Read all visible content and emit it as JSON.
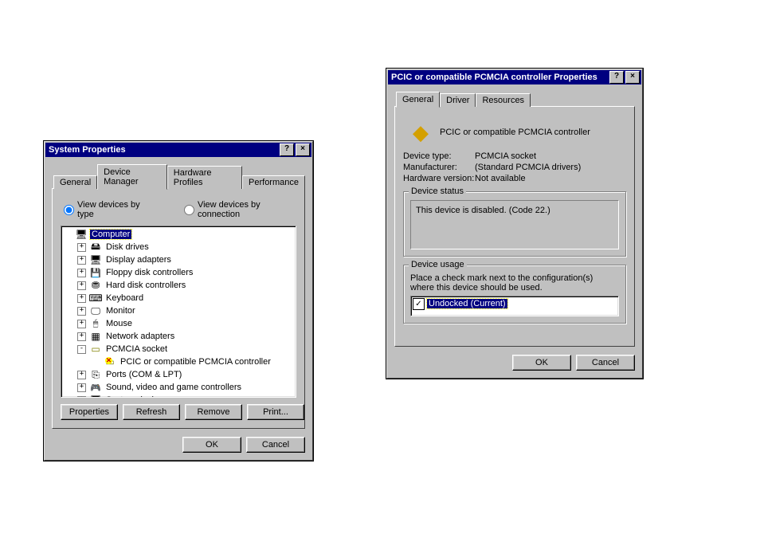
{
  "dlg1": {
    "title": "System Properties",
    "tabs": [
      "General",
      "Device Manager",
      "Hardware Profiles",
      "Performance"
    ],
    "active_tab": 1,
    "radio1": "View devices by type",
    "radio2": "View devices by connection",
    "tree": [
      {
        "indent": 0,
        "exp": "",
        "icon": "computer",
        "label": "Computer",
        "selected": true
      },
      {
        "indent": 1,
        "exp": "+",
        "icon": "disk",
        "label": "Disk drives"
      },
      {
        "indent": 1,
        "exp": "+",
        "icon": "display",
        "label": "Display adapters"
      },
      {
        "indent": 1,
        "exp": "+",
        "icon": "floppy",
        "label": "Floppy disk controllers"
      },
      {
        "indent": 1,
        "exp": "+",
        "icon": "hdd",
        "label": "Hard disk controllers"
      },
      {
        "indent": 1,
        "exp": "+",
        "icon": "keyboard",
        "label": "Keyboard"
      },
      {
        "indent": 1,
        "exp": "+",
        "icon": "monitor",
        "label": "Monitor"
      },
      {
        "indent": 1,
        "exp": "+",
        "icon": "mouse",
        "label": "Mouse"
      },
      {
        "indent": 1,
        "exp": "+",
        "icon": "network",
        "label": "Network adapters"
      },
      {
        "indent": 1,
        "exp": "-",
        "icon": "pcmcia",
        "label": "PCMCIA socket"
      },
      {
        "indent": 2,
        "exp": "",
        "icon": "pcmcia-warn",
        "label": "PCIC or compatible PCMCIA controller"
      },
      {
        "indent": 1,
        "exp": "+",
        "icon": "ports",
        "label": "Ports (COM & LPT)"
      },
      {
        "indent": 1,
        "exp": "+",
        "icon": "sound",
        "label": "Sound, video and game controllers"
      },
      {
        "indent": 1,
        "exp": "+",
        "icon": "system",
        "label": "System devices"
      }
    ],
    "btn_props": "Properties",
    "btn_refresh": "Refresh",
    "btn_remove": "Remove",
    "btn_print": "Print...",
    "btn_ok": "OK",
    "btn_cancel": "Cancel"
  },
  "dlg2": {
    "title": "PCIC or compatible PCMCIA controller Properties",
    "tabs": [
      "General",
      "Driver",
      "Resources"
    ],
    "active_tab": 0,
    "device_name": "PCIC or compatible PCMCIA controller",
    "row_type_lbl": "Device type:",
    "row_type_val": "PCMCIA socket",
    "row_mfr_lbl": "Manufacturer:",
    "row_mfr_val": "(Standard PCMCIA drivers)",
    "row_hw_lbl": "Hardware version:",
    "row_hw_val": "Not available",
    "grp_status": "Device status",
    "status_text": "This device is disabled. (Code 22.)",
    "grp_usage": "Device usage",
    "usage_instr": "Place a check mark next to the configuration(s) where this device should be used.",
    "usage_item": "Undocked (Current)",
    "btn_ok": "OK",
    "btn_cancel": "Cancel"
  }
}
